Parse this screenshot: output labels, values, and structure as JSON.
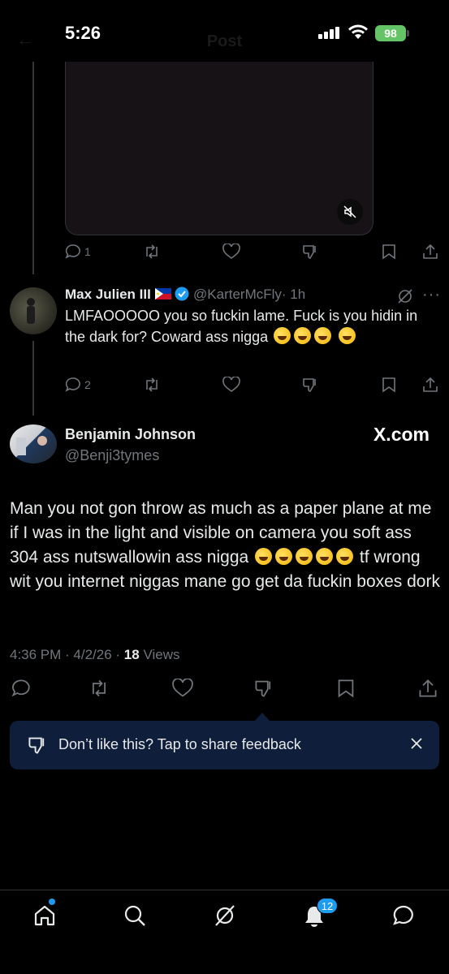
{
  "status_bar": {
    "time": "5:26",
    "battery": "98",
    "ghost_title": "Post"
  },
  "quoted_post": {
    "reply_count": "1"
  },
  "reply": {
    "name": "Max Julien III",
    "flag": "Philippines flag",
    "verified": true,
    "handle": "@KarterMcFly",
    "time": "· 1h",
    "text": "LMFAOOOOO you so fuckin lame. Fuck is you hidin in the dark for? Coward ass nigga",
    "emoji": "rolling-on-floor-laughing",
    "reply_count": "2"
  },
  "main_post": {
    "name": "Benjamin Johnson",
    "handle": "@Benji3tymes",
    "source_label": "X.com",
    "text_part1": "Man you not gon throw as much as a paper plane at me if I was in the light and visible on camera you soft ass 304 ass nutswallowin ass nigga",
    "text_part2": "tf wrong wit you internet niggas mane go get da fuckin boxes dork",
    "emoji": "face-with-tears-of-joy",
    "timestamp": "4:36 PM · 4/2/26 · ",
    "views_count": "18",
    "views_label": " Views"
  },
  "feedback": {
    "text": "Don’t like this? Tap to share feedback"
  },
  "tabbar": {
    "notification_count": "12"
  },
  "colors": {
    "accent": "#1d9bf0",
    "muted": "#71767b",
    "feedback_bg": "#0e1e3b",
    "battery": "#65c466"
  }
}
